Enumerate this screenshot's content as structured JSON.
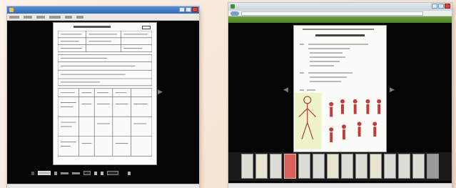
{
  "left_window": {
    "title": "",
    "menu": [
      "",
      "",
      "",
      "",
      "",
      ""
    ],
    "document": {
      "title": "",
      "ref": ""
    },
    "status": ""
  },
  "right_window": {
    "title": "",
    "document": {
      "header": "",
      "title": ""
    },
    "status": ""
  },
  "icons": {
    "prev_page": "chevron-left-icon",
    "next_page": "chevron-right-icon"
  },
  "colors": {
    "background": "#f6e6d6",
    "viewer_bg": "#050505",
    "left_titlebar": "#2f6bb8",
    "right_greenbar": "#4c7f26",
    "selected_thumb": "#d9635c"
  }
}
